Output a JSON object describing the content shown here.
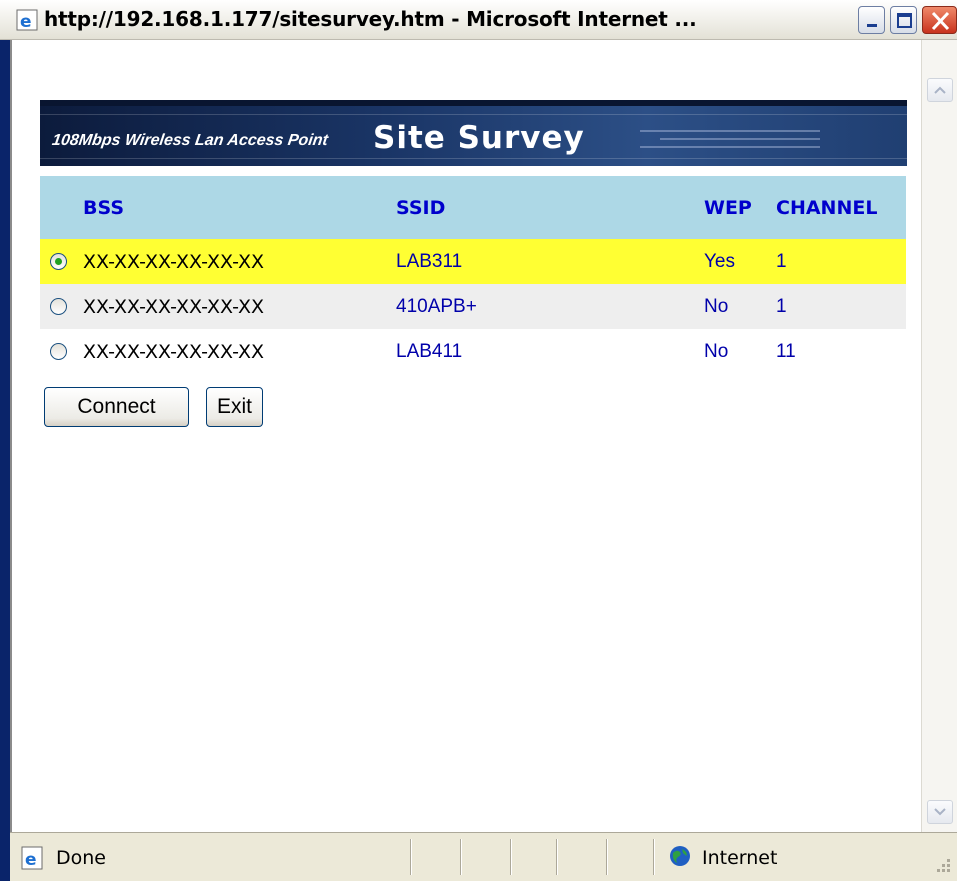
{
  "window": {
    "title": "http://192.168.1.177/sitesurvey.htm - Microsoft Internet ...",
    "controls": [
      "minimize-icon",
      "maximize-icon",
      "close-icon"
    ]
  },
  "banner": {
    "subtitle": "108Mbps Wireless Lan Access Point",
    "title": "Site Survey"
  },
  "table": {
    "headers": [
      "BSS",
      "SSID",
      "WEP",
      "CHANNEL"
    ],
    "rows": [
      {
        "selected": true,
        "bss": "XX-XX-XX-XX-XX-XX",
        "ssid": "LAB311",
        "wep": "Yes",
        "channel": "1"
      },
      {
        "selected": false,
        "bss": "XX-XX-XX-XX-XX-XX",
        "ssid": "410APB+",
        "wep": "No",
        "channel": "1"
      },
      {
        "selected": false,
        "bss": "XX-XX-XX-XX-XX-XX",
        "ssid": "LAB411",
        "wep": "No",
        "channel": "11"
      }
    ]
  },
  "buttons": {
    "connect": "Connect",
    "exit": "Exit"
  },
  "status": {
    "text": "Done",
    "zone": "Internet"
  },
  "colors": {
    "header_bg": "#add8e6",
    "selected_row": "#ffff33",
    "alt_row": "#eeeeee",
    "link_blue": "#0000aa"
  }
}
